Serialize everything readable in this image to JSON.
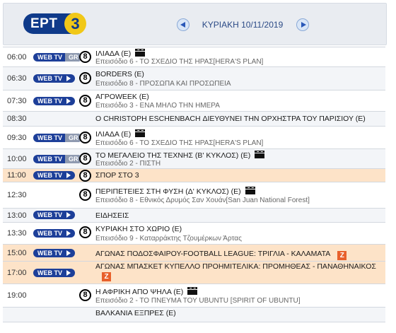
{
  "header": {
    "logo_text": "ΕΡΤ",
    "logo_number": "3",
    "date_label": "ΚΥΡΙΑΚΗ   10/11/2019"
  },
  "colors": {
    "row_orange": "#fde3c8",
    "badge_blue": "#1d3f99",
    "zapping_orange": "#e8602b"
  },
  "badges": {
    "webtv": "WEB TV",
    "gr": "GR"
  },
  "rating": "8",
  "zapping": "Z",
  "schedule": [
    {
      "time": "06:00",
      "badge": "webtv-gr",
      "rating": true,
      "title": "ΙΛΙΑΔΑ  (E)",
      "clap": true,
      "episode": "Επεισόδιο 6 - ΤΟ ΣΧΕΔΙΟ ΤΗΣ ΗΡΑΣ[HERA'S PLAN]",
      "style": "white"
    },
    {
      "time": "06:30",
      "badge": "webtv",
      "rating": true,
      "title": "BORDERS  (E)",
      "episode": "Επεισόδιο 8 - ΠΡΟΣΩΠΑ ΚΑΙ ΠΡΟΣΩΠΕΙΑ",
      "style": "grey"
    },
    {
      "time": "07:30",
      "badge": "webtv",
      "rating": true,
      "title": "ΑΓΡΟWEEK  (E)",
      "episode": "Επεισόδιο 3 - ΕΝΑ ΜΗΛΟ ΤΗΝ ΗΜΕΡΑ",
      "style": "white"
    },
    {
      "time": "08:30",
      "title": "Ο CHRISTOPH ESCHENBACH ΔΙΕΥΘΥΝΕΙ ΤΗΝ ΟΡΧΗΣΤΡΑ ΤΟΥ ΠΑΡΙΣΙΟΥ  (E)",
      "style": "grey"
    },
    {
      "time": "09:30",
      "badge": "webtv-gr",
      "rating": true,
      "title": "ΙΛΙΑΔΑ  (E)",
      "clap": true,
      "episode": "Επεισόδιο 6 - ΤΟ ΣΧΕΔΙΟ ΤΗΣ ΗΡΑΣ[HERA'S PLAN]",
      "style": "white"
    },
    {
      "time": "10:00",
      "badge": "webtv-gr",
      "rating": true,
      "title": "ΤΟ ΜΕΓΑΛΕΙΟ ΤΗΣ ΤΕΧΝΗΣ  (Β' ΚΥΚΛΟΣ)  (E)",
      "clap": true,
      "episode": "Επεισόδιο 2 - ΠΙΣΤΗ",
      "style": "grey"
    },
    {
      "time": "11:00",
      "badge": "webtv",
      "rating": true,
      "title": "ΣΠΟΡ ΣΤΟ 3",
      "style": "orange"
    },
    {
      "time": "12:30",
      "rating": true,
      "title": "ΠΕΡΙΠΕΤΕΙΕΣ ΣΤΗ ΦΥΣΗ  (Δ' ΚΥΚΛΟΣ)  (E)",
      "clap": true,
      "episode": "Επεισόδιο 8 - Εθνικός Δρυμός Σαν Χουάν[San Juan National Forest]",
      "style": "white"
    },
    {
      "time": "13:00",
      "badge": "webtv",
      "title": "ΕΙΔΗΣΕΙΣ",
      "style": "grey"
    },
    {
      "time": "13:30",
      "badge": "webtv",
      "rating": true,
      "title": "ΚΥΡΙΑΚΗ ΣΤΟ ΧΩΡΙΟ  (E)",
      "episode": "Επεισόδιο 9 - Καταρράκτης Τζουμέρκων Άρτας",
      "style": "white"
    },
    {
      "time": "15:00",
      "badge": "webtv",
      "title": "ΑΓΩΝΑΣ ΠΟΔΟΣΦΑΙΡΟΥ-FOOTBALL LEAGUE: ΤΡΙΓΛΙΑ - ΚΑΛΑΜΑΤΑ",
      "zapping": true,
      "style": "orange"
    },
    {
      "time": "17:00",
      "badge": "webtv",
      "title": "ΑΓΩΝΑΣ ΜΠΑΣΚΕΤ ΚΥΠΕΛΛΟ ΠΡΟΗΜΙΤΕΛΙΚΑ: ΠΡΟΜΗΘΕΑΣ - ΠΑΝΑΘΗΝΑΙΚΟΣ",
      "zapping_below": true,
      "style": "orange"
    },
    {
      "time": "19:00",
      "rating": true,
      "title": "Η ΑΦΡΙΚΗ ΑΠΟ ΨΗΛΑ  (E)",
      "clap": true,
      "episode": "Επεισόδιο 2 - ΤΟ ΠΝΕΥΜΑ ΤΟΥ UBUNTU [SPIRIT OF UBUNTU]",
      "style": "white"
    },
    {
      "title": "ΒΑΛΚΑΝΙΑ ΕΞΠΡΕΣ  (E)",
      "style": "grey"
    }
  ]
}
